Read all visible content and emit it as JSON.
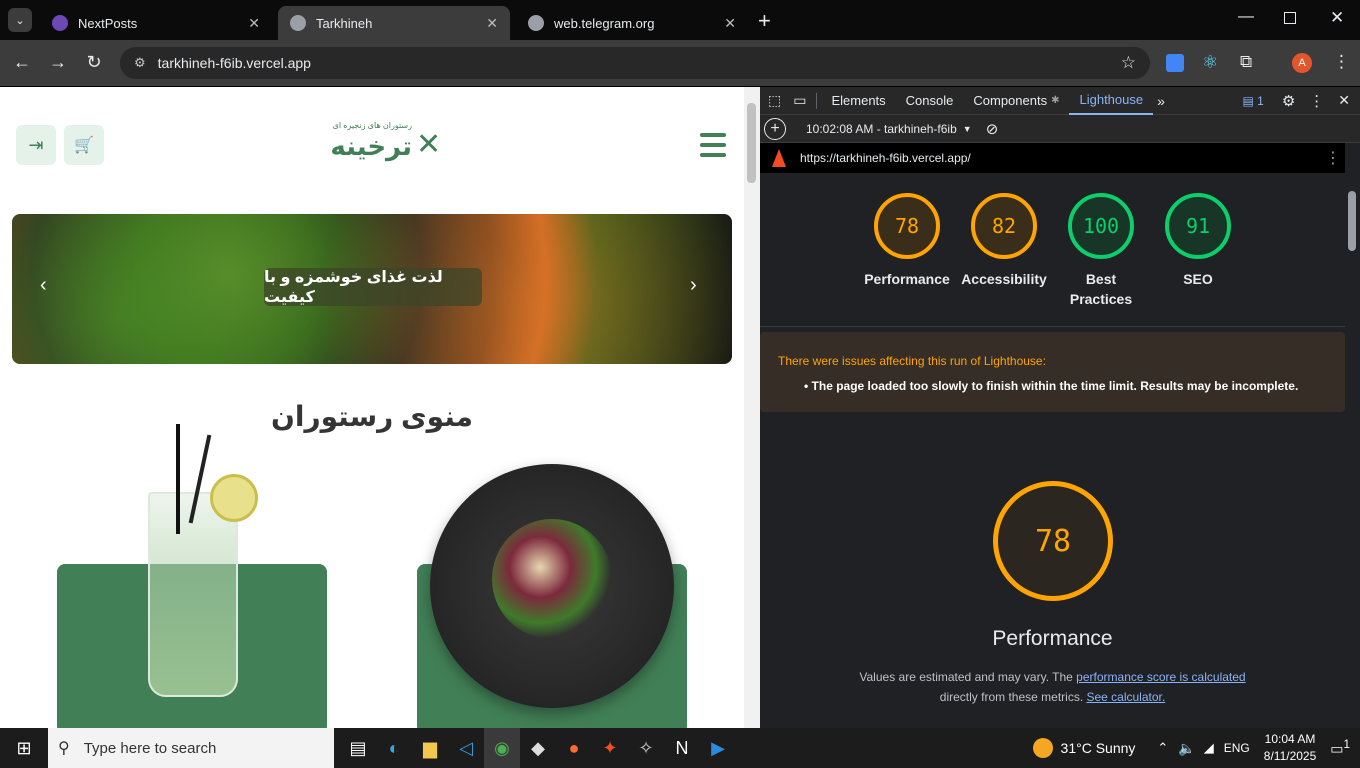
{
  "browser": {
    "tabs": [
      {
        "title": "NextPosts",
        "favicon_color": "#6c4ab6"
      },
      {
        "title": "Tarkhineh",
        "favicon_color": "#9aa0a6"
      },
      {
        "title": "web.telegram.org",
        "favicon_color": "#9aa0a6"
      }
    ],
    "url": "tarkhineh-f6ib.vercel.app",
    "profile_initial": "A"
  },
  "site": {
    "logo_text": "ترخینه",
    "logo_tagline": "رستوران های زنجیره ای",
    "banner_text": "لذت غذای خوشمزه و با کیفیت",
    "menu_title": "منوی رستوران",
    "accent": "#417f56"
  },
  "devtools": {
    "tabs": [
      "Elements",
      "Console",
      "Components",
      "Lighthouse"
    ],
    "issues_count": "1",
    "report_time": "10:02:08 AM - tarkhineh-f6ib",
    "report_url": "https://tarkhineh-f6ib.vercel.app/",
    "scores": [
      {
        "label": "Performance",
        "value": "78",
        "color": "#ffa400"
      },
      {
        "label": "Accessibility",
        "value": "82",
        "color": "#ffa400"
      },
      {
        "label": "Best Practices",
        "value": "100",
        "color": "#0cce6b"
      },
      {
        "label": "SEO",
        "value": "91",
        "color": "#0cce6b"
      }
    ],
    "warning_title": "There were issues affecting this run of Lighthouse:",
    "warning_item": "The page loaded too slowly to finish within the time limit. Results may be incomplete.",
    "perf_score": "78",
    "perf_title": "Performance",
    "perf_desc_1": "Values are estimated and may vary. The ",
    "perf_link_1": "performance score is calculated",
    "perf_desc_2": "directly from these metrics. ",
    "perf_link_2": "See calculator."
  },
  "taskbar": {
    "search_placeholder": "Type here to search",
    "weather": "31°C  Sunny",
    "lang": "ENG",
    "time": "10:04 AM",
    "date": "8/11/2025",
    "notif_count": "1"
  }
}
